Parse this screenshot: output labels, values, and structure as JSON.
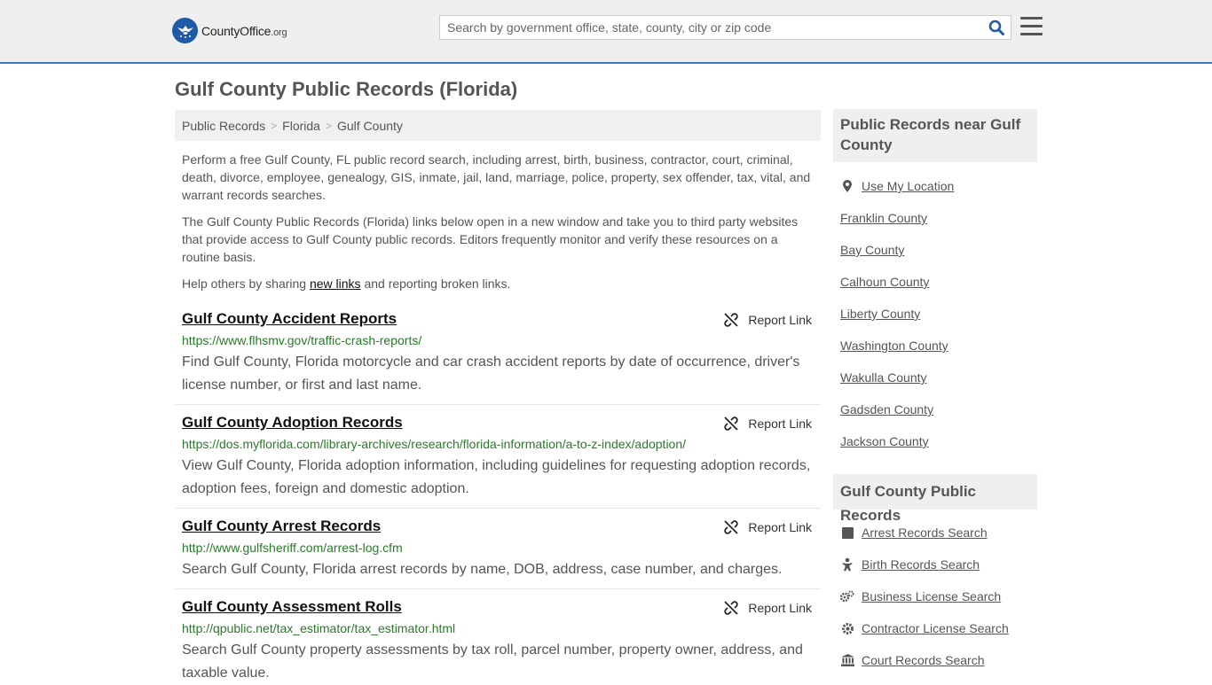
{
  "header": {
    "logo_brand": "CountyOffice",
    "logo_tld": ".org",
    "search_placeholder": "Search by government office, state, county, city or zip code"
  },
  "page": {
    "title": "Gulf County Public Records (Florida)",
    "breadcrumb": [
      "Public Records",
      "Florida",
      "Gulf County"
    ],
    "intro1": "Perform a free Gulf County, FL public record search, including arrest, birth, business, contractor, court, criminal, death, divorce, employee, genealogy, GIS, inmate, jail, land, marriage, police, property, sex offender, tax, vital, and warrant records searches.",
    "intro2": "The Gulf County Public Records (Florida) links below open in a new window and take you to third party websites that provide access to Gulf County public records. Editors frequently monitor and verify these resources on a routine basis.",
    "help_prefix": "Help others by sharing ",
    "help_link": "new links",
    "help_suffix": " and reporting broken links."
  },
  "records": [
    {
      "title": "Gulf County Accident Reports",
      "url": "https://www.flhsmv.gov/traffic-crash-reports/",
      "desc": "Find Gulf County, Florida motorcycle and car crash accident reports by date of occurrence, driver's license number, or first and last name.",
      "report": "Report Link"
    },
    {
      "title": "Gulf County Adoption Records",
      "url": "https://dos.myflorida.com/library-archives/research/florida-information/a-to-z-index/adoption/",
      "desc": "View Gulf County, Florida adoption information, including guidelines for requesting adoption records, adoption fees, foreign and domestic adoption.",
      "report": "Report Link"
    },
    {
      "title": "Gulf County Arrest Records",
      "url": "http://www.gulfsheriff.com/arrest-log.cfm",
      "desc": "Search Gulf County, Florida arrest records by name, DOB, address, case number, and charges.",
      "report": "Report Link"
    },
    {
      "title": "Gulf County Assessment Rolls",
      "url": "http://qpublic.net/tax_estimator/tax_estimator.html",
      "desc": "Search Gulf County property assessments by tax roll, parcel number, property owner, address, and taxable value.",
      "report": "Report Link"
    }
  ],
  "sidebar": {
    "near_title": "Public Records near Gulf County",
    "use_location": "Use My Location",
    "nearby": [
      "Franklin County",
      "Bay County",
      "Calhoun County",
      "Liberty County",
      "Washington County",
      "Wakulla County",
      "Gadsden County",
      "Jackson County"
    ],
    "records_title": "Gulf County Public Records",
    "record_links": [
      {
        "label": "Arrest Records Search",
        "icon": "square-icon"
      },
      {
        "label": "Birth Records Search",
        "icon": "baby-icon"
      },
      {
        "label": "Business License Search",
        "icon": "cogs-icon"
      },
      {
        "label": "Contractor License Search",
        "icon": "gear-icon"
      },
      {
        "label": "Court Records Search",
        "icon": "courthouse-icon"
      }
    ]
  }
}
